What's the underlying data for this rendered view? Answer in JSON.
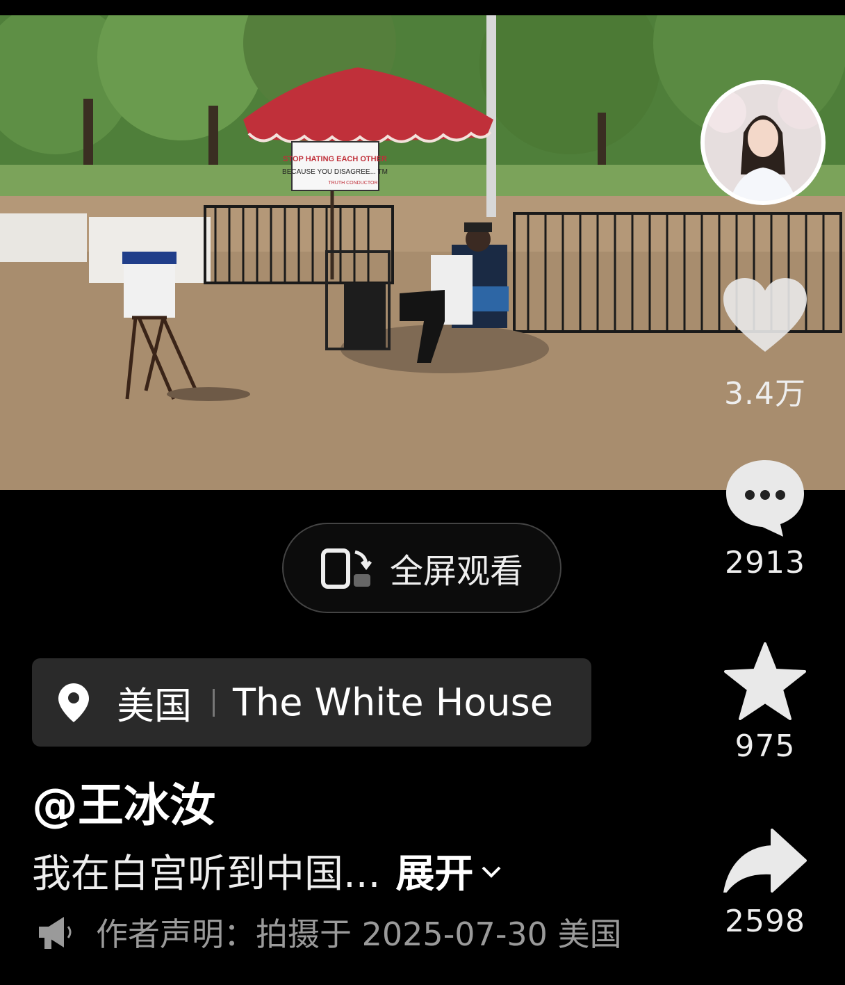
{
  "video": {
    "sign_line1": "STOP HATING EACH OTHER",
    "sign_line2": "BECAUSE YOU DISAGREE... TM",
    "sign_line3": "TRUTH CONDUCTOR"
  },
  "actions": {
    "like_count": "3.4万",
    "comment_count": "2913",
    "favorite_count": "975",
    "share_count": "2598"
  },
  "fullscreen": {
    "label": "全屏观看"
  },
  "location": {
    "country": "美国",
    "place": "The White House"
  },
  "author": {
    "handle": "@王冰汝"
  },
  "caption": {
    "text": "我在白宫听到中国...",
    "expand_label": "展开"
  },
  "statement": {
    "text": "作者声明：拍摄于 2025-07-30 美国"
  },
  "colors": {
    "background": "#000000",
    "umbrella": "#c0303a",
    "chip": "#2a2a2a"
  }
}
